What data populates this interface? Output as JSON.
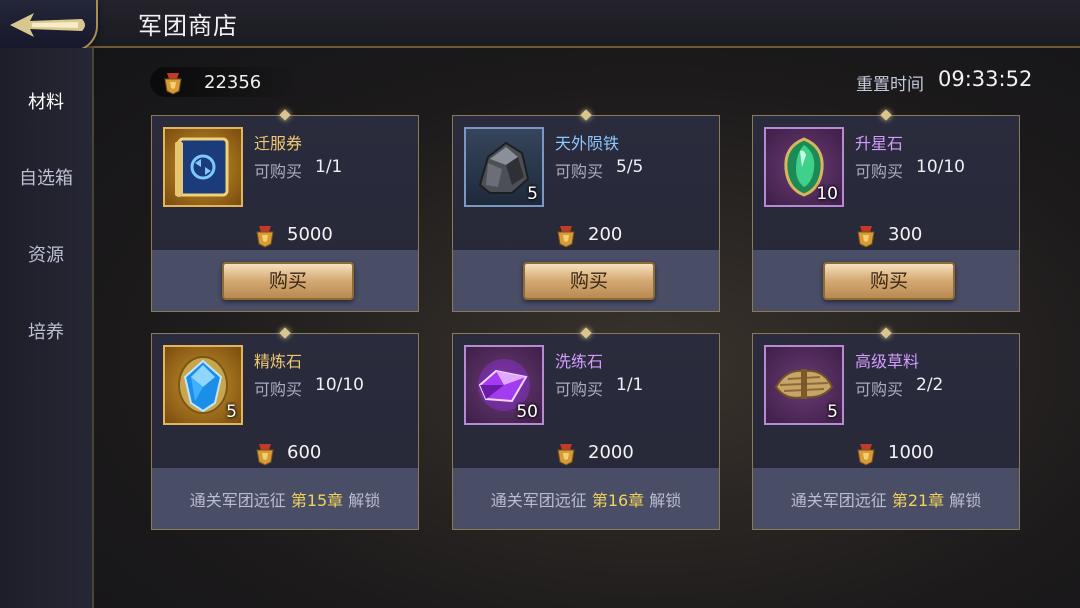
{
  "header": {
    "title": "军团商店"
  },
  "sidebar": {
    "items": [
      {
        "label": "材料",
        "active": true
      },
      {
        "label": "自选箱",
        "active": false
      },
      {
        "label": "资源",
        "active": false
      },
      {
        "label": "培养",
        "active": false
      }
    ]
  },
  "currency": {
    "icon": "guild-medal-icon",
    "amount": "22356"
  },
  "reset": {
    "label": "重置时间",
    "time": "09:33:52"
  },
  "limit_label": "可购买",
  "items": [
    {
      "name": "迁服券",
      "limit": "1/1",
      "qty": "",
      "price": "5000",
      "buy_label": "购买",
      "icon": "ticket-icon",
      "rarity_color": "#f0c874"
    },
    {
      "name": "天外陨铁",
      "limit": "5/5",
      "qty": "5",
      "price": "200",
      "buy_label": "购买",
      "icon": "meteorite-icon",
      "rarity_color": "#8ec6ff"
    },
    {
      "name": "升星石",
      "limit": "10/10",
      "qty": "10",
      "price": "300",
      "buy_label": "购买",
      "icon": "green-gem-icon",
      "rarity_color": "#d59cff"
    },
    {
      "name": "精炼石",
      "limit": "10/10",
      "qty": "5",
      "price": "600",
      "lock": {
        "prefix": "通关军团远征",
        "chapter": "第15章",
        "suffix": "解锁"
      },
      "icon": "blue-crystal-icon",
      "rarity_color": "#f0c874"
    },
    {
      "name": "洗练石",
      "limit": "1/1",
      "qty": "50",
      "price": "2000",
      "lock": {
        "prefix": "通关军团远征",
        "chapter": "第16章",
        "suffix": "解锁"
      },
      "icon": "purple-crystal-icon",
      "rarity_color": "#d59cff"
    },
    {
      "name": "高级草料",
      "limit": "2/2",
      "qty": "5",
      "price": "1000",
      "lock": {
        "prefix": "通关军团远征",
        "chapter": "第21章",
        "suffix": "解锁"
      },
      "icon": "hay-icon",
      "rarity_color": "#d59cff"
    }
  ]
}
